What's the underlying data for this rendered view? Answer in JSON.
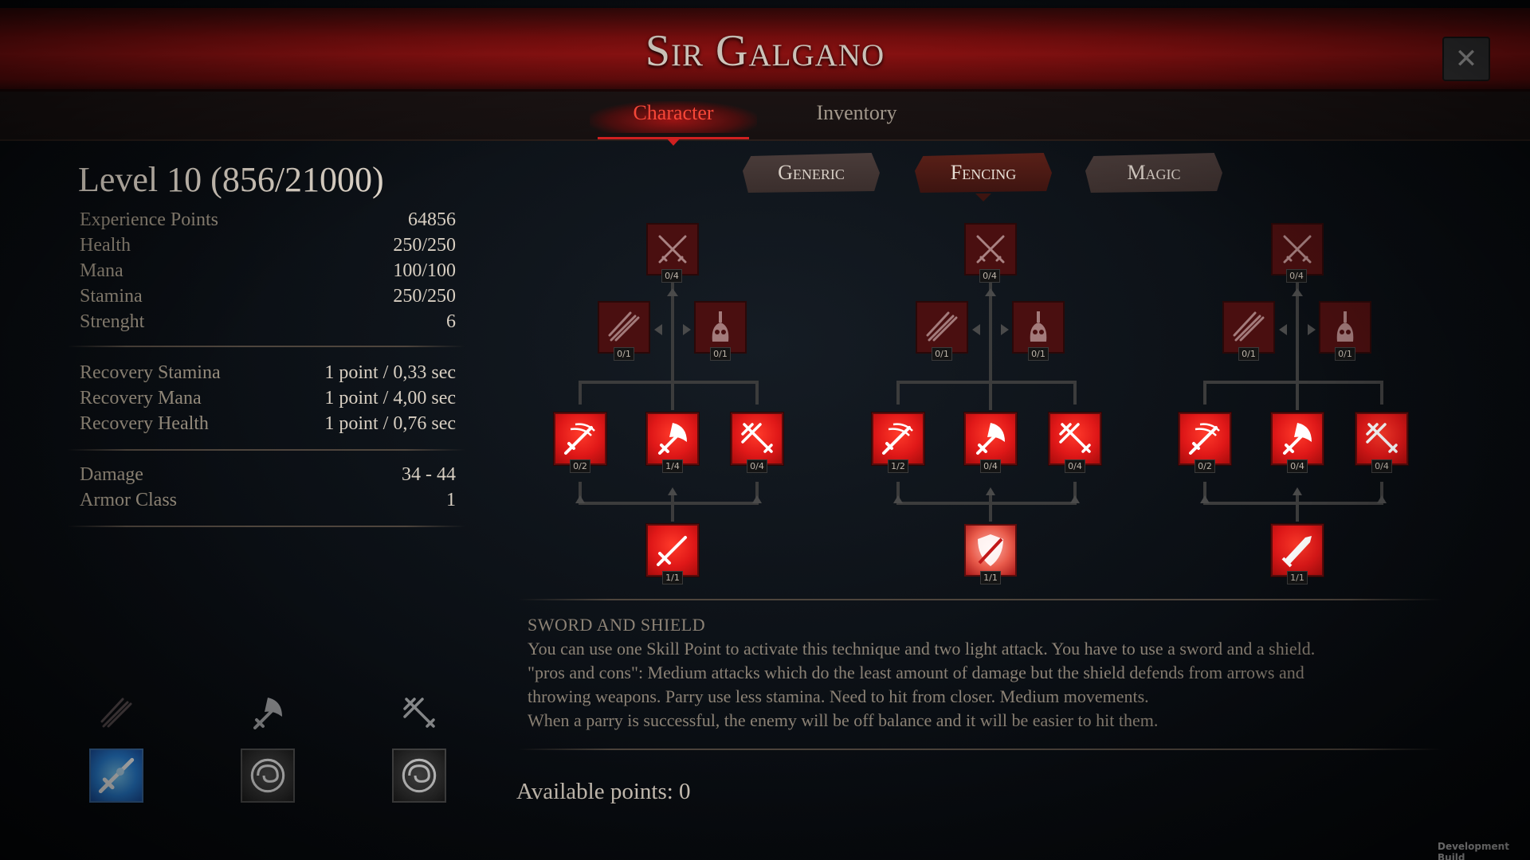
{
  "header": {
    "title": "Sir Galgano",
    "close_icon": "close-icon"
  },
  "tabs": [
    {
      "label": "Character",
      "active": true
    },
    {
      "label": "Inventory",
      "active": false
    }
  ],
  "character": {
    "level_text": "Level 10 (856/21000)",
    "stats": [
      {
        "label": "Experience Points",
        "value": "64856"
      },
      {
        "label": "Health",
        "value": "250/250"
      },
      {
        "label": "Mana",
        "value": "100/100"
      },
      {
        "label": "Stamina",
        "value": "250/250"
      },
      {
        "label": "Strenght",
        "value": "6"
      }
    ],
    "recovery": [
      {
        "label": "Recovery Stamina",
        "value": "1 point / 0,33 sec"
      },
      {
        "label": "Recovery Mana",
        "value": "1 point / 4,00 sec"
      },
      {
        "label": "Recovery Health",
        "value": "1 point / 0,76 sec"
      }
    ],
    "combat": [
      {
        "label": "Damage",
        "value": "34 - 44"
      },
      {
        "label": "Armor Class",
        "value": "1"
      }
    ]
  },
  "categories": [
    {
      "label": "Generic",
      "active": false
    },
    {
      "label": "Fencing",
      "active": true
    },
    {
      "label": "Magic",
      "active": false
    }
  ],
  "skill_trees": [
    {
      "top": "0/4",
      "mid_left": "0/1",
      "mid_right": "0/1",
      "row": [
        "0/2",
        "1/4",
        "0/4"
      ],
      "base": "1/1",
      "base_icon": "sword-icon"
    },
    {
      "top": "0/4",
      "mid_left": "0/1",
      "mid_right": "0/1",
      "row": [
        "1/2",
        "0/4",
        "0/4"
      ],
      "base": "1/1",
      "base_icon": "shield-sword-icon"
    },
    {
      "top": "0/4",
      "mid_left": "0/1",
      "mid_right": "0/1",
      "row": [
        "0/2",
        "0/4",
        "0/4"
      ],
      "base": "1/1",
      "base_icon": "greatsword-icon"
    }
  ],
  "description": {
    "title": "SWORD AND SHIELD",
    "lines": [
      "You can use one Skill Point to activate this technique and two light attack. You have to use a sword and a shield.",
      "\"pros and cons\": Medium attacks which do the least amount of damage but the shield defends from arrows and",
      "throwing weapons. Parry use less stamina. Need to hit from closer. Medium movements.",
      "When a parry is successful, the enemy will be off balance and it will be easier to hit them."
    ]
  },
  "available_points": "Available points: 0",
  "quick_slots": {
    "small": [
      "sword-slash-icon",
      "axe-slash-icon",
      "arrows-icon"
    ],
    "large": [
      "blue-sword-icon",
      "swirl-icon",
      "swirl-icon"
    ]
  },
  "footer": {
    "dev_build": "Development Build"
  },
  "colors": {
    "accent_red": "#e01818",
    "tab_active": "#ff4a3a",
    "text": "#c9bfae"
  }
}
